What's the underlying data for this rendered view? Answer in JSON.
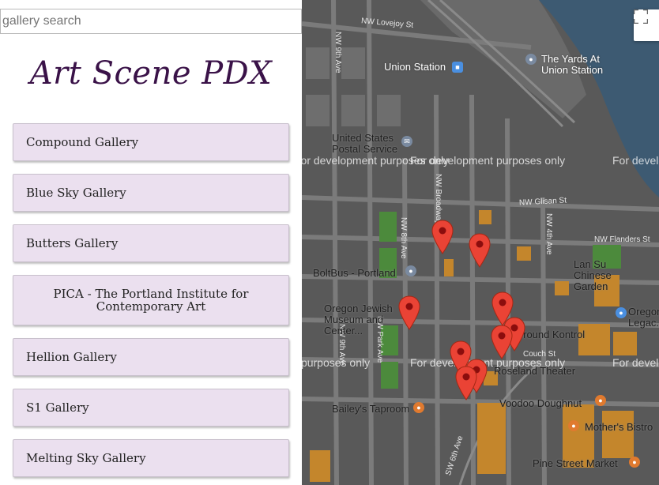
{
  "search": {
    "placeholder": "gallery search"
  },
  "site_title": "Art Scene PDX",
  "galleries": [
    "Compound Gallery",
    "Blue Sky Gallery",
    "Butters Gallery",
    "PICA - The Portland Institute for Contemporary Art",
    "Hellion Gallery",
    "S1 Gallery",
    "Melting Sky Gallery"
  ],
  "map": {
    "watermark": "For development purposes only",
    "labels": {
      "union_station": "Union Station",
      "yards": "The Yards At Union Station",
      "post_office": "United States Postal Service",
      "boltbus": "BoltBus - Portland",
      "jewish_museum": "Oregon Jewish Museum and Center...",
      "lan_su": "Lan Su Chinese Garden",
      "ground_kontrol": "Ground Kontrol",
      "roseland": "Roseland Theater",
      "baileys": "Bailey's Taproom",
      "voodoo": "Voodoo Doughnut",
      "mothers": "Mother's Bistro",
      "pine_street": "Pine Street Market",
      "oregon_legacy": "Oregon Legac..."
    },
    "streets": {
      "lovejoy": "NW Lovejoy St",
      "glisan": "NW Glisan St",
      "flanders": "NW Flanders St",
      "couch": "Couch St",
      "broadway": "NW Broadway",
      "eighth": "NW 8th Ave",
      "ninth": "NW 9th Ave",
      "park": "NW Park Ave",
      "fourth": "NW 4th Ave",
      "sixth": "SW 6th Ave"
    },
    "colors": {
      "marker": "#ea4335",
      "marker_dot": "#8b0d0d",
      "park": "#4c8a3c"
    }
  }
}
